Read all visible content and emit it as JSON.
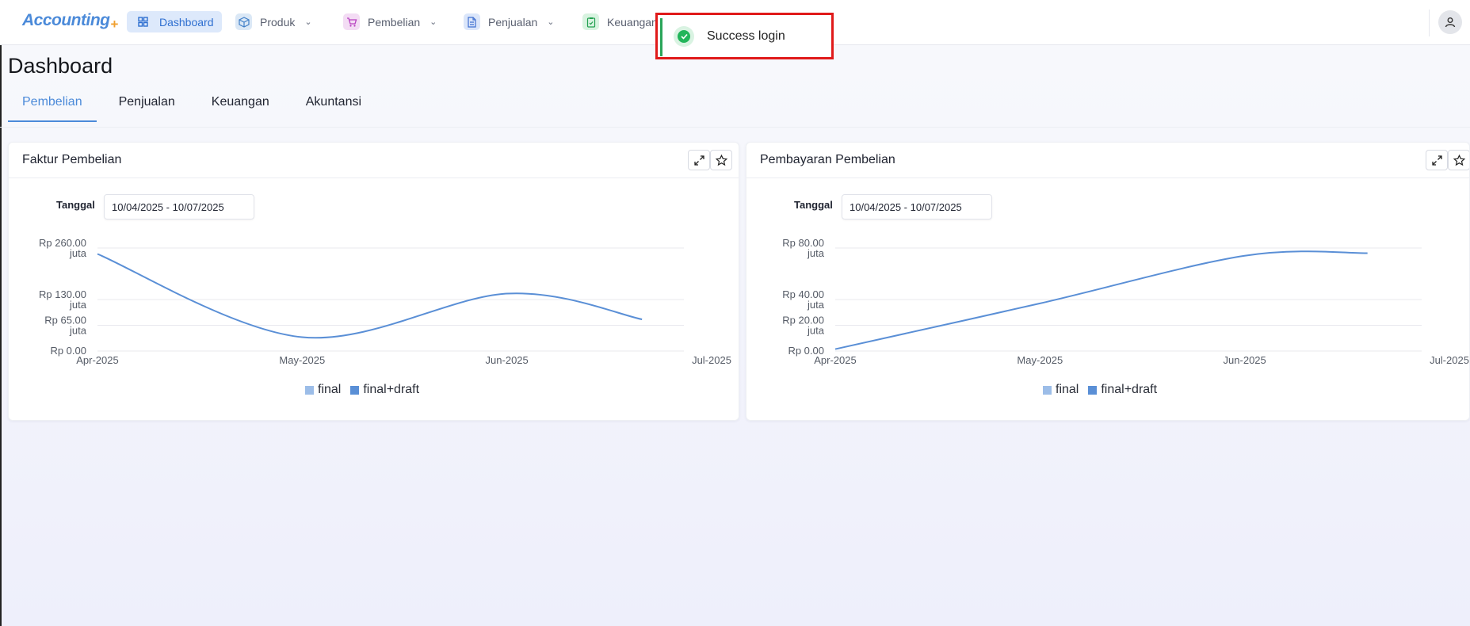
{
  "app": {
    "logo": "Accounting",
    "logo_plus": "+"
  },
  "nav": {
    "items": [
      {
        "label": "Dashboard",
        "icon": "dashboard-icon",
        "active": true
      },
      {
        "label": "Produk",
        "icon": "box-icon"
      },
      {
        "label": "Pembelian",
        "icon": "cart-icon"
      },
      {
        "label": "Penjualan",
        "icon": "document-icon"
      },
      {
        "label": "Keuangan",
        "icon": "wallet-icon"
      }
    ]
  },
  "toast": {
    "message": "Success login"
  },
  "page": {
    "title": "Dashboard"
  },
  "tabs": [
    {
      "label": "Pembelian",
      "active": true
    },
    {
      "label": "Penjualan"
    },
    {
      "label": "Keuangan"
    },
    {
      "label": "Akuntansi"
    }
  ],
  "cards": [
    {
      "title": "Faktur Pembelian",
      "date_label": "Tanggal",
      "date_range": "10/04/2025 - 10/07/2025",
      "legend": [
        "final",
        "final+draft"
      ]
    },
    {
      "title": "Pembayaran Pembelian",
      "date_label": "Tanggal",
      "date_range": "10/04/2025 - 10/07/2025",
      "legend": [
        "final",
        "final+draft"
      ]
    }
  ],
  "colors": {
    "accent": "#4b8ad9",
    "series_final": "#9cbde8",
    "series_final_draft": "#5a8fd6",
    "toast_border": "#e01a1a",
    "success": "#22b55a"
  },
  "chart_data": [
    {
      "type": "line",
      "title": "Faktur Pembelian",
      "x": [
        "Apr-2025",
        "May-2025",
        "Jun-2025",
        "Jul-2025"
      ],
      "y_ticks": [
        {
          "value": 0,
          "label": "Rp 0.00",
          "unit": ""
        },
        {
          "value": 65,
          "label": "Rp 65.00",
          "unit": "juta"
        },
        {
          "value": 130,
          "label": "Rp 130.00",
          "unit": "juta"
        },
        {
          "value": 260,
          "label": "Rp 260.00",
          "unit": "juta"
        }
      ],
      "ylim": [
        0,
        260
      ],
      "series": [
        {
          "name": "final+draft",
          "points": [
            [
              0,
              245
            ],
            [
              1,
              35
            ],
            [
              2,
              145
            ],
            [
              2.66,
              80
            ]
          ]
        }
      ]
    },
    {
      "type": "line",
      "title": "Pembayaran Pembelian",
      "x": [
        "Apr-2025",
        "May-2025",
        "Jun-2025",
        "Jul-2025"
      ],
      "y_ticks": [
        {
          "value": 0,
          "label": "Rp 0.00",
          "unit": ""
        },
        {
          "value": 20,
          "label": "Rp 20.00",
          "unit": "juta"
        },
        {
          "value": 40,
          "label": "Rp 40.00",
          "unit": "juta"
        },
        {
          "value": 80,
          "label": "Rp 80.00",
          "unit": "juta"
        }
      ],
      "ylim": [
        0,
        80
      ],
      "series": [
        {
          "name": "final+draft",
          "points": [
            [
              0,
              1.5
            ],
            [
              1,
              37
            ],
            [
              2,
              74
            ],
            [
              2.6,
              76
            ]
          ]
        }
      ]
    }
  ]
}
